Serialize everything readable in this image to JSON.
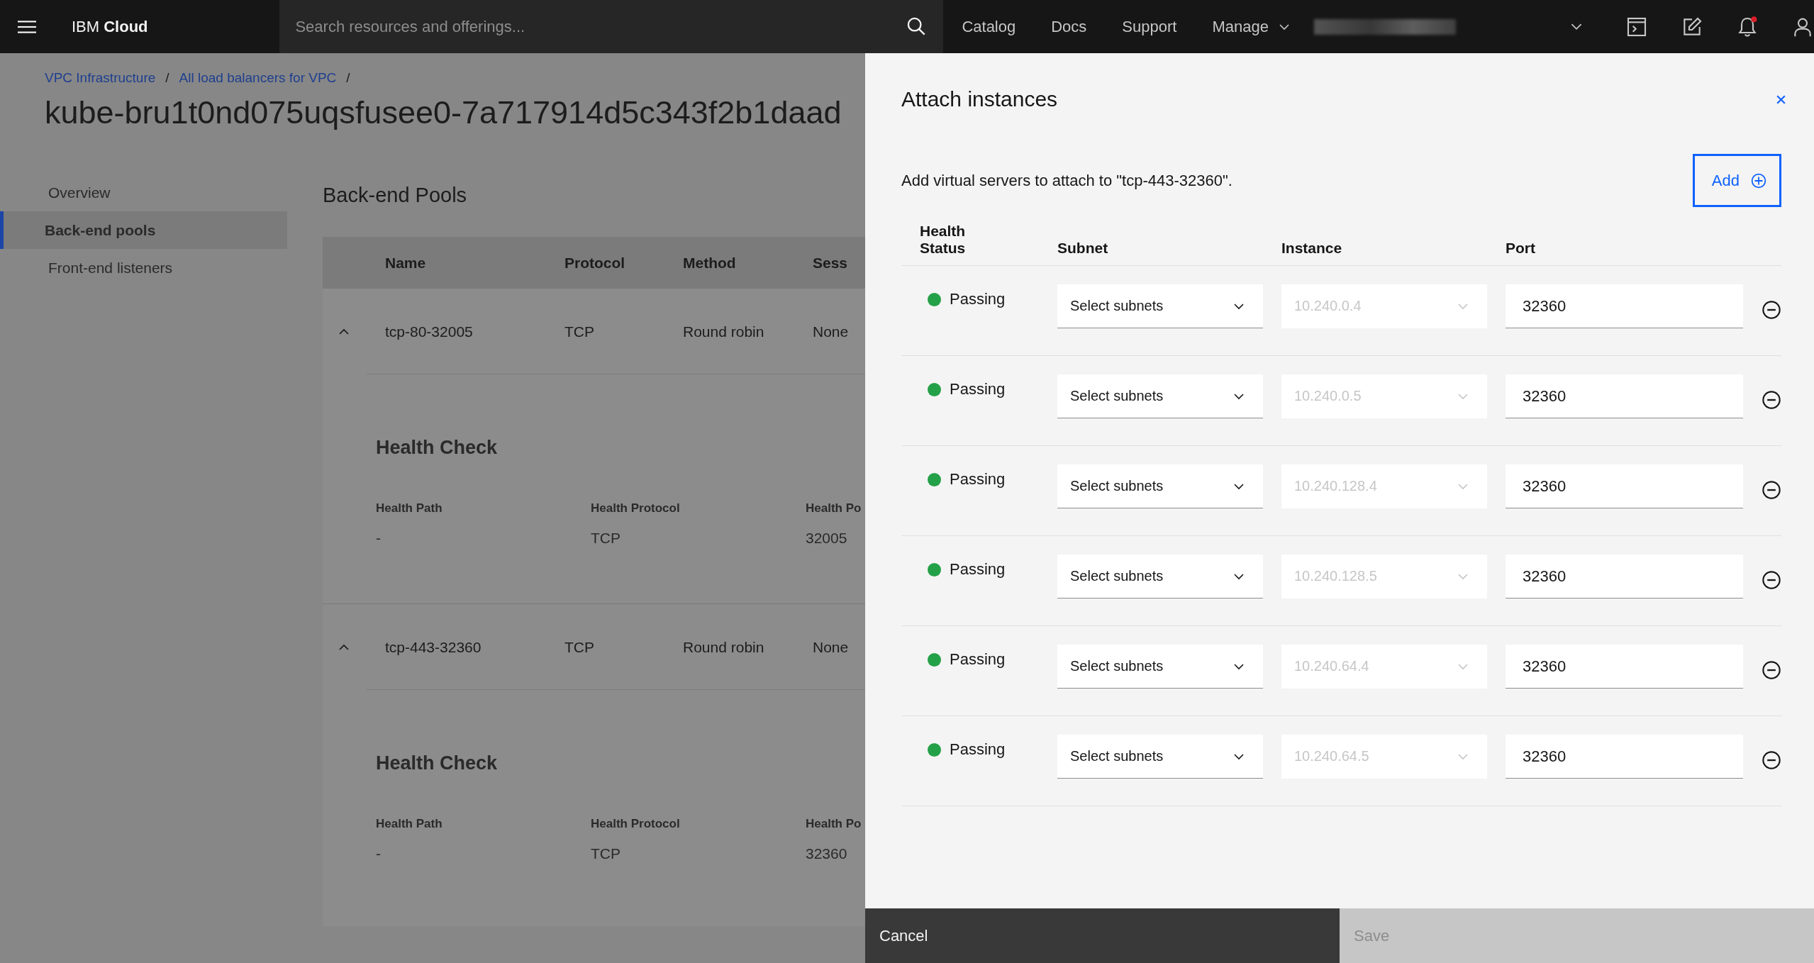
{
  "top_bar": {
    "brand": "IBM **Cloud**",
    "search": {
      "placeholder": "Search resources and offerings..."
    },
    "nav": [
      {
        "label": "Catalog",
        "has_menu": false
      },
      {
        "label": "Docs",
        "has_menu": false
      },
      {
        "label": "Support",
        "has_menu": false
      },
      {
        "label": "Manage",
        "has_menu": true
      }
    ],
    "notification_unread": true
  },
  "breadcrumbs": {
    "items": [
      "VPC Infrastructure",
      "All load balancers for VPC"
    ],
    "separator": "/"
  },
  "title": "kube-bru1t0nd075uqsfusee0-7a717914d5c343f2b1daad",
  "side_nav": [
    {
      "label": "Overview",
      "selected": false
    },
    {
      "label": "Back-end pools",
      "selected": true
    },
    {
      "label": "Front-end listeners",
      "selected": false
    }
  ],
  "pools": {
    "heading": "Back-end Pools",
    "columns": [
      "Name",
      "Protocol",
      "Method",
      "Sess"
    ],
    "rows": [
      {
        "name": "tcp-80-32005",
        "protocol": "TCP",
        "method": "Round robin",
        "column_4": "None",
        "expanded": true,
        "health_check": {
          "heading": "Health Check",
          "fields": [
            {
              "label": "Health Path",
              "value": "-"
            },
            {
              "label": "Health Protocol",
              "value": "TCP"
            },
            {
              "label": "Health Po",
              "value": "32005"
            }
          ]
        }
      },
      {
        "name": "tcp-443-32360",
        "protocol": "TCP",
        "method": "Round robin",
        "column_4": "None",
        "expanded": true,
        "health_check": {
          "heading": "Health Check",
          "fields": [
            {
              "label": "Health Path",
              "value": "-"
            },
            {
              "label": "Health Protocol",
              "value": "TCP"
            },
            {
              "label": "Health Po",
              "value": "32360"
            }
          ]
        }
      }
    ]
  },
  "modal": {
    "title": "Attach instances",
    "description": "Add virtual servers to attach to \"tcp-443-32360\".",
    "add_button": "Add",
    "columns": [
      "Health Status",
      "Subnet",
      "Instance",
      "Port"
    ],
    "instances": [
      {
        "health": {
          "label": "Passing",
          "color": "#24a148"
        },
        "subnet": "Select subnets",
        "instance": "10.240.0.4",
        "instance_disabled": true,
        "port": "32360"
      },
      {
        "health": {
          "label": "Passing",
          "color": "#24a148"
        },
        "subnet": "Select subnets",
        "instance": "10.240.0.5",
        "instance_disabled": true,
        "port": "32360"
      },
      {
        "health": {
          "label": "Passing",
          "color": "#24a148"
        },
        "subnet": "Select subnets",
        "instance": "10.240.128.4",
        "instance_disabled": true,
        "port": "32360"
      },
      {
        "health": {
          "label": "Passing",
          "color": "#24a148"
        },
        "subnet": "Select subnets",
        "instance": "10.240.128.5",
        "instance_disabled": true,
        "port": "32360"
      },
      {
        "health": {
          "label": "Passing",
          "color": "#24a148"
        },
        "subnet": "Select subnets",
        "instance": "10.240.64.4",
        "instance_disabled": true,
        "port": "32360"
      },
      {
        "health": {
          "label": "Passing",
          "color": "#24a148"
        },
        "subnet": "Select subnets",
        "instance": "10.240.64.5",
        "instance_disabled": true,
        "port": "32360"
      }
    ],
    "footer": {
      "cancel": "Cancel",
      "save": "Save",
      "save_disabled": true
    }
  }
}
